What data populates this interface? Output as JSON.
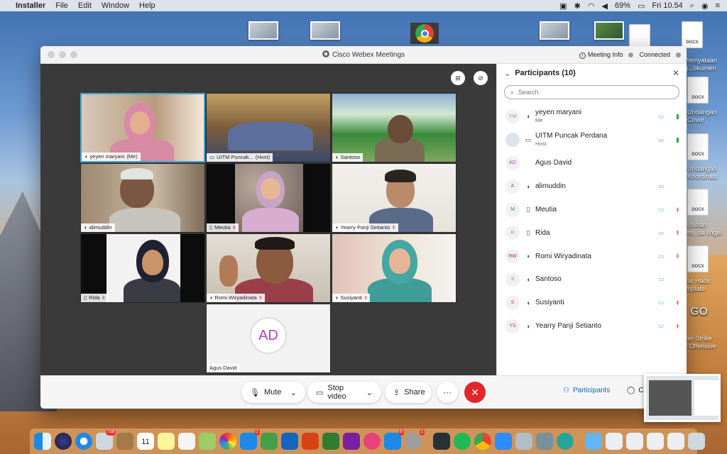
{
  "menubar": {
    "app": "Installer",
    "items": [
      "File",
      "Edit",
      "Window",
      "Help"
    ],
    "battery": "69%",
    "clock": "Fri 10.54"
  },
  "desktop": {
    "labels": [
      "DOCX",
      "Pernyataan",
      "g...okumen",
      "DOCX",
      "Undangan",
      "Cover",
      "DOCX",
      "Undangan",
      "Koordinasi",
      "DOCX",
      "utuhan",
      "m...sa Ilngei",
      "DOCX",
      "tar Hadir",
      "mplate",
      "GO",
      "ter-Strike",
      "l Offensive"
    ]
  },
  "window": {
    "title": "Cisco Webex Meetings",
    "meeting_info": "Meeting Info",
    "status": "Connected"
  },
  "grid": {
    "tiles": [
      {
        "name": "yeyen maryani",
        "tag": "(Me)"
      },
      {
        "name": "UITM Puncak...",
        "tag": "(Host)"
      },
      {
        "name": "Santoso"
      },
      {
        "name": "alimuddin"
      },
      {
        "name": "Meutia"
      },
      {
        "name": "Yearry Panji Setianto"
      },
      {
        "name": "Rida"
      },
      {
        "name": "Romi Wiryadinata"
      },
      {
        "name": "Susiyanti"
      },
      {
        "name": "Agus David"
      }
    ],
    "agus_initials": "AD"
  },
  "controls": {
    "mute": "Mute",
    "stop_video": "Stop video",
    "share": "Share",
    "more": "···",
    "end": "✕",
    "participants_tab": "Participants",
    "chat_tab": "C"
  },
  "panel": {
    "title": "Participants (10)",
    "search_placeholder": "Search",
    "participants": [
      {
        "initials": "YM",
        "name": "yeyen maryani",
        "sub": "Me",
        "mic": "on"
      },
      {
        "initials": "",
        "name": "UITM Puncak Perdana",
        "sub": "Host",
        "mic": "on"
      },
      {
        "initials": "AD",
        "name": "Agus David",
        "sub": "",
        "mic": ""
      },
      {
        "initials": "A",
        "name": "alimuddin",
        "sub": "",
        "mic": ""
      },
      {
        "initials": "M",
        "name": "Meutia",
        "sub": "",
        "mic": "off"
      },
      {
        "initials": "R",
        "name": "Rida",
        "sub": "",
        "mic": "off"
      },
      {
        "initials": "RW",
        "name": "Romi Wiryadinata",
        "sub": "",
        "mic": "off"
      },
      {
        "initials": "S",
        "name": "Santoso",
        "sub": "",
        "mic": ""
      },
      {
        "initials": "S",
        "name": "Susiyanti",
        "sub": "",
        "mic": "off"
      },
      {
        "initials": "YS",
        "name": "Yearry Panji Setianto",
        "sub": "",
        "mic": "off"
      }
    ]
  },
  "dock": {
    "badges": {
      "photos": "738",
      "messages": "1",
      "appstore": "8",
      "prefs": "1"
    },
    "calendar_day": "11"
  },
  "colors": {
    "accent": "#1565c0",
    "end_call": "#e2262a",
    "active_border": "#3fa7d9"
  }
}
